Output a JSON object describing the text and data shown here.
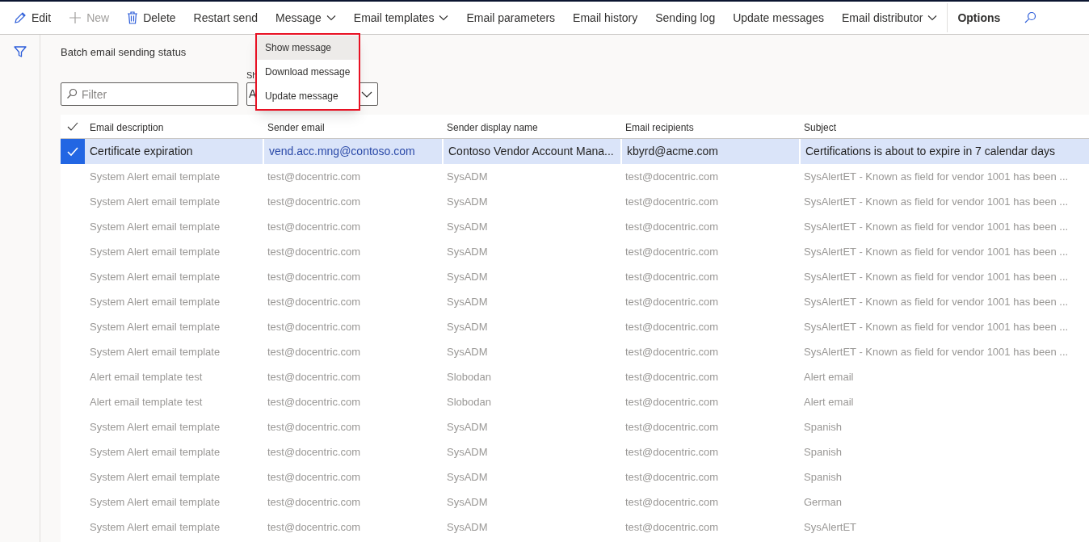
{
  "toolbar": [
    {
      "label": "Edit",
      "kind": "pencil",
      "disabled": false,
      "dropdown": false,
      "bold": false
    },
    {
      "label": "New",
      "kind": "plus",
      "disabled": true,
      "dropdown": false,
      "bold": false
    },
    {
      "label": "Delete",
      "kind": "trash",
      "disabled": false,
      "dropdown": false,
      "bold": false
    },
    {
      "label": "Restart send",
      "disabled": false,
      "dropdown": false,
      "bold": false
    },
    {
      "label": "Message",
      "disabled": false,
      "dropdown": true,
      "bold": false
    },
    {
      "label": "Email templates",
      "disabled": false,
      "dropdown": true,
      "bold": false
    },
    {
      "label": "Email parameters",
      "disabled": false,
      "dropdown": false,
      "bold": false
    },
    {
      "label": "Email history",
      "disabled": false,
      "dropdown": false,
      "bold": false
    },
    {
      "label": "Sending log",
      "disabled": false,
      "dropdown": false,
      "bold": false
    },
    {
      "label": "Update messages",
      "disabled": false,
      "dropdown": false,
      "bold": false
    },
    {
      "label": "Email distributor",
      "disabled": false,
      "dropdown": true,
      "bold": false
    },
    {
      "label": "Options",
      "disabled": false,
      "dropdown": false,
      "bold": true,
      "separator_before": true
    }
  ],
  "menu": {
    "items": [
      {
        "label": "Show message",
        "selected": true
      },
      {
        "label": "Download message",
        "selected": false
      },
      {
        "label": "Update message",
        "selected": false
      }
    ]
  },
  "page_title": "Batch email sending status",
  "filter": {
    "placeholder": "Filter"
  },
  "show_field": {
    "label": "Sh",
    "value": "A"
  },
  "table": {
    "columns": [
      "Email description",
      "Sender email",
      "Sender display name",
      "Email recipients",
      "Subject"
    ],
    "rows": [
      {
        "selected": true,
        "cells": [
          "Certificate expiration",
          "vend.acc.mng@contoso.com",
          "Contoso Vendor Account Mana...",
          "kbyrd@acme.com",
          "Certifications is about to expire in 7 calendar days"
        ]
      },
      {
        "selected": false,
        "cells": [
          "System Alert email template",
          "test@docentric.com",
          "SysADM",
          "test@docentric.com",
          "SysAlertET - Known as field for vendor 1001 has been ..."
        ]
      },
      {
        "selected": false,
        "cells": [
          "System Alert email template",
          "test@docentric.com",
          "SysADM",
          "test@docentric.com",
          "SysAlertET - Known as field for vendor 1001 has been ..."
        ]
      },
      {
        "selected": false,
        "cells": [
          "System Alert email template",
          "test@docentric.com",
          "SysADM",
          "test@docentric.com",
          "SysAlertET - Known as field for vendor 1001 has been ..."
        ]
      },
      {
        "selected": false,
        "cells": [
          "System Alert email template",
          "test@docentric.com",
          "SysADM",
          "test@docentric.com",
          "SysAlertET - Known as field for vendor 1001 has been ..."
        ]
      },
      {
        "selected": false,
        "cells": [
          "System Alert email template",
          "test@docentric.com",
          "SysADM",
          "test@docentric.com",
          "SysAlertET - Known as field for vendor 1001 has been ..."
        ]
      },
      {
        "selected": false,
        "cells": [
          "System Alert email template",
          "test@docentric.com",
          "SysADM",
          "test@docentric.com",
          "SysAlertET - Known as field for vendor 1001 has been ..."
        ]
      },
      {
        "selected": false,
        "cells": [
          "System Alert email template",
          "test@docentric.com",
          "SysADM",
          "test@docentric.com",
          "SysAlertET - Known as field for vendor 1001 has been ..."
        ]
      },
      {
        "selected": false,
        "cells": [
          "System Alert email template",
          "test@docentric.com",
          "SysADM",
          "test@docentric.com",
          "SysAlertET - Known as field for vendor 1001 has been ..."
        ]
      },
      {
        "selected": false,
        "cells": [
          "Alert email template test",
          "test@docentric.com",
          "Slobodan",
          "test@docentric.com",
          "Alert email"
        ]
      },
      {
        "selected": false,
        "cells": [
          "Alert email template test",
          "test@docentric.com",
          "Slobodan",
          "test@docentric.com",
          "Alert email"
        ]
      },
      {
        "selected": false,
        "cells": [
          "System Alert email template",
          "test@docentric.com",
          "SysADM",
          "test@docentric.com",
          "Spanish"
        ]
      },
      {
        "selected": false,
        "cells": [
          "System Alert email template",
          "test@docentric.com",
          "SysADM",
          "test@docentric.com",
          "Spanish"
        ]
      },
      {
        "selected": false,
        "cells": [
          "System Alert email template",
          "test@docentric.com",
          "SysADM",
          "test@docentric.com",
          "Spanish"
        ]
      },
      {
        "selected": false,
        "cells": [
          "System Alert email template",
          "test@docentric.com",
          "SysADM",
          "test@docentric.com",
          "German"
        ]
      },
      {
        "selected": false,
        "cells": [
          "System Alert email template",
          "test@docentric.com",
          "SysADM",
          "test@docentric.com",
          "SysAlertET"
        ]
      }
    ]
  }
}
